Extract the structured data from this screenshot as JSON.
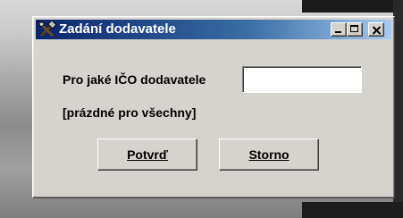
{
  "window": {
    "title": "Zadání dodavatele",
    "title_icon": "tools-icon"
  },
  "titlebar_buttons": {
    "minimize_icon": "minimize-icon",
    "maximize_icon": "maximize-icon",
    "close_icon": "close-icon"
  },
  "form": {
    "ico_label": "Pro jaké IČO dodavatele",
    "ico_value": "",
    "hint": "[prázdné pro všechny]"
  },
  "buttons": {
    "confirm_label": "Potvrď",
    "cancel_label": "Storno"
  },
  "colors": {
    "titlebar_start": "#0a246a",
    "titlebar_end": "#a6caf0",
    "dialog_face": "#d6d3ce"
  }
}
